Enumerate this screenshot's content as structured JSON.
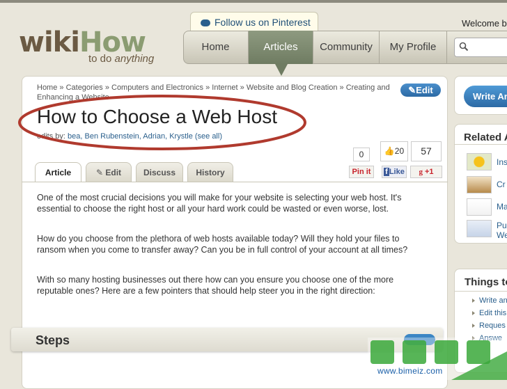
{
  "header": {
    "logo_main": "wiki",
    "logo_accent": "How",
    "tagline_prefix": "to do ",
    "tagline_emph": "anything",
    "pinterest": "Follow us on Pinterest",
    "welcome": "Welcome b"
  },
  "nav": {
    "items": [
      {
        "label": "Home"
      },
      {
        "label": "Articles"
      },
      {
        "label": "Community"
      },
      {
        "label": "My Profile"
      }
    ],
    "active_index": 1
  },
  "article": {
    "breadcrumb": "Home » Categories » Computers and Electronics » Internet » Website and Blog Creation » Creating and Enhancing a Website",
    "edit_label": "Edit",
    "title": "How to Choose a Web Host",
    "edited_by_label": "edits by: ",
    "edited_by_names": "bea, Ben Rubenstein, Adrian, Krystle (see all)",
    "tabs": [
      "Article",
      "Edit",
      "Discuss",
      "History"
    ],
    "paragraphs": [
      "One of the most crucial decisions you will make for your website is selecting your web host. It's essential to choose the right host or all your hard work could be wasted or even worse, lost.",
      "How do you choose from the plethora of web hosts available today? Will they hold your files to ransom when you come to transfer away? Can you be in full control of your account at all times?",
      "With so many hosting businesses out there how can you ensure you choose one of the more reputable ones? Here are a few pointers that should help steer you in the right direction:"
    ],
    "steps_heading": "Steps"
  },
  "social": {
    "pinterest_count": "0",
    "pinterest_label": "Pin it",
    "facebook_count": "20",
    "facebook_label": "Like",
    "google_count": "57",
    "google_label": "+1"
  },
  "sidebar": {
    "write_label": "Write An",
    "related_heading": "Related A",
    "related_items": [
      "Ins",
      "Cr",
      "Ma",
      "Pu",
      "We"
    ],
    "things_heading": "Things to",
    "things_links": [
      "Write an",
      "Edit this",
      "Reques",
      "Answe"
    ]
  },
  "watermark": {
    "url": "www.bimeiz.com"
  },
  "colors": {
    "brand_brown": "#6b5a43",
    "brand_green": "#8b9c72",
    "nav_active": "#7a8870",
    "link_blue": "#2a5f8c",
    "highlight_red": "#b03a2e"
  }
}
